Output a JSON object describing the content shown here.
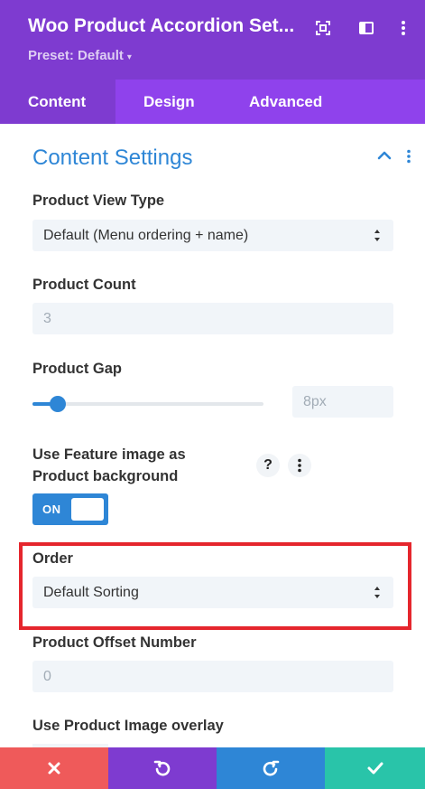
{
  "header": {
    "title": "Woo Product Accordion Set...",
    "preset_label": "Preset: Default",
    "icons": [
      "screen-capture-icon",
      "sidebar-layout-icon",
      "more-vertical-icon"
    ]
  },
  "tabs": [
    {
      "label": "Content",
      "active": true
    },
    {
      "label": "Design",
      "active": false
    },
    {
      "label": "Advanced",
      "active": false
    }
  ],
  "section": {
    "title": "Content Settings"
  },
  "fields": {
    "product_view_type": {
      "label": "Product View Type",
      "value": "Default (Menu ordering + name)"
    },
    "product_count": {
      "label": "Product Count",
      "placeholder": "3"
    },
    "product_gap": {
      "label": "Product Gap",
      "value": "8px",
      "level": 0.11
    },
    "feature_image": {
      "label_line1": "Use Feature image as",
      "label_line2": "Product background",
      "toggle": "ON",
      "help": "?"
    },
    "order": {
      "label": "Order",
      "value": "Default Sorting"
    },
    "offset": {
      "label": "Product Offset Number",
      "placeholder": "0"
    },
    "image_overlay": {
      "label": "Use Product Image overlay"
    }
  },
  "footer": {
    "buttons": [
      {
        "name": "discard",
        "icon": "close-icon",
        "color": "#ef5a5a"
      },
      {
        "name": "undo",
        "icon": "undo-icon",
        "color": "#7e3bd0"
      },
      {
        "name": "redo",
        "icon": "redo-icon",
        "color": "#2e86d6"
      },
      {
        "name": "save",
        "icon": "check-icon",
        "color": "#29c4a9"
      }
    ]
  },
  "colors": {
    "header_bg": "#7e3bd0",
    "tabs_bg": "#8f42ec",
    "accent": "#2e86d6",
    "highlight": "#e5262d"
  }
}
